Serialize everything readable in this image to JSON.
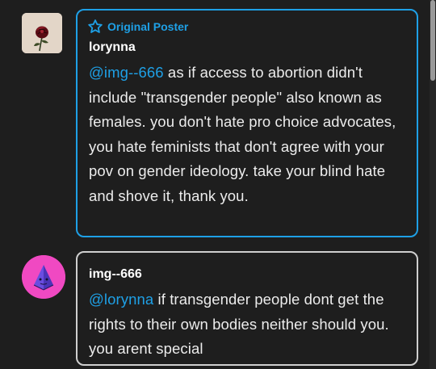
{
  "colors": {
    "background": "#1e1e1e",
    "accent": "#1ea0e6",
    "reply_border": "#cfcfcf",
    "reply_avatar": "#f049c2"
  },
  "original_post": {
    "badge_icon": "star-outline-icon",
    "badge_label": "Original Poster",
    "avatar_icon": "red-rose-icon",
    "username": "lorynna",
    "mention": "@img--666",
    "body": " as if access to abortion didn't include \"transgender people\" also known as females. you don't hate pro choice advocates, you hate feminists that don't agree with your pov on gender ideology. take your blind hate and shove it, thank you."
  },
  "reply": {
    "avatar_icon": "purple-pyramid-icon",
    "username": "img--666",
    "mention": "@lorynna",
    "body": " if transgender people dont get the rights to their own bodies neither should you. you arent special"
  }
}
